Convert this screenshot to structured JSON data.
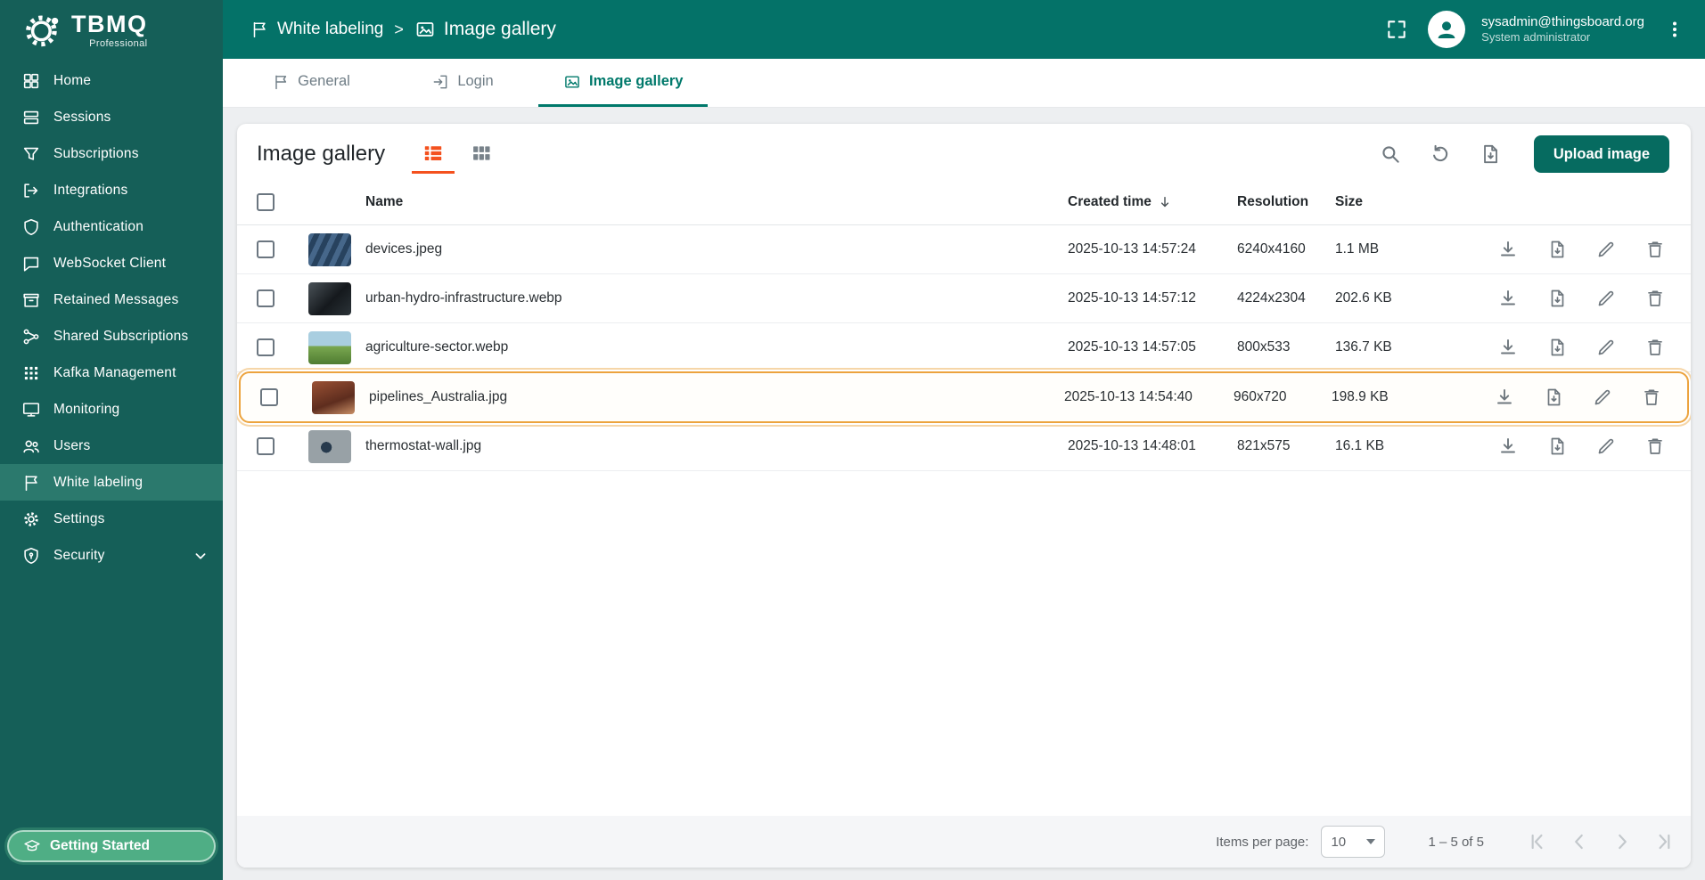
{
  "app": {
    "name": "TBMQ",
    "edition": "Professional"
  },
  "header": {
    "breadcrumb": {
      "parent": "White labeling",
      "separator": ">",
      "current": "Image gallery"
    },
    "user": {
      "email": "sysadmin@thingsboard.org",
      "role": "System administrator"
    }
  },
  "sidebar": {
    "items": [
      {
        "label": "Home",
        "icon": "home-icon",
        "active": false
      },
      {
        "label": "Sessions",
        "icon": "sessions-icon",
        "active": false
      },
      {
        "label": "Subscriptions",
        "icon": "filter-icon",
        "active": false
      },
      {
        "label": "Integrations",
        "icon": "integrations-icon",
        "active": false
      },
      {
        "label": "Authentication",
        "icon": "shield-icon",
        "active": false
      },
      {
        "label": "WebSocket Client",
        "icon": "chat-icon",
        "active": false
      },
      {
        "label": "Retained Messages",
        "icon": "archive-icon",
        "active": false
      },
      {
        "label": "Shared Subscriptions",
        "icon": "share-icon",
        "active": false
      },
      {
        "label": "Kafka Management",
        "icon": "apps-grid-icon",
        "active": false
      },
      {
        "label": "Monitoring",
        "icon": "monitor-icon",
        "active": false
      },
      {
        "label": "Users",
        "icon": "users-icon",
        "active": false
      },
      {
        "label": "White labeling",
        "icon": "flag-icon",
        "active": true
      },
      {
        "label": "Settings",
        "icon": "gear-icon",
        "active": false
      },
      {
        "label": "Security",
        "icon": "security-icon",
        "active": false,
        "expandable": true
      }
    ],
    "getting_started_label": "Getting Started"
  },
  "tabs": [
    {
      "label": "General",
      "active": false
    },
    {
      "label": "Login",
      "active": false
    },
    {
      "label": "Image gallery",
      "active": true
    }
  ],
  "gallery": {
    "title": "Image gallery",
    "view_mode": "list",
    "upload_button_label": "Upload image",
    "table": {
      "columns": {
        "name": "Name",
        "created_time": "Created time",
        "resolution": "Resolution",
        "size": "Size"
      },
      "sort": {
        "column": "Created time",
        "direction": "desc"
      },
      "rows": [
        {
          "name": "devices.jpeg",
          "created_time": "2025-10-13 14:57:24",
          "resolution": "6240x4160",
          "size": "1.1 MB",
          "highlighted": false
        },
        {
          "name": "urban-hydro-infrastructure.webp",
          "created_time": "2025-10-13 14:57:12",
          "resolution": "4224x2304",
          "size": "202.6 KB",
          "highlighted": false
        },
        {
          "name": "agriculture-sector.webp",
          "created_time": "2025-10-13 14:57:05",
          "resolution": "800x533",
          "size": "136.7 KB",
          "highlighted": false
        },
        {
          "name": "pipelines_Australia.jpg",
          "created_time": "2025-10-13 14:54:40",
          "resolution": "960x720",
          "size": "198.9 KB",
          "highlighted": true
        },
        {
          "name": "thermostat-wall.jpg",
          "created_time": "2025-10-13 14:48:01",
          "resolution": "821x575",
          "size": "16.1 KB",
          "highlighted": false
        }
      ]
    }
  },
  "paginator": {
    "items_per_page_label": "Items per page:",
    "items_per_page_value": "10",
    "range_label": "1 – 5 of 5"
  },
  "colors": {
    "sidebar_bg": "#155f58",
    "header_bg": "#047268",
    "accent_teal": "#00796b",
    "active_item_bg": "#2b796d",
    "list_toggle_active": "#f4511e",
    "highlight_border": "#eca33d",
    "upload_button_bg": "#066b60",
    "getting_started_bg": "#4fae85"
  }
}
